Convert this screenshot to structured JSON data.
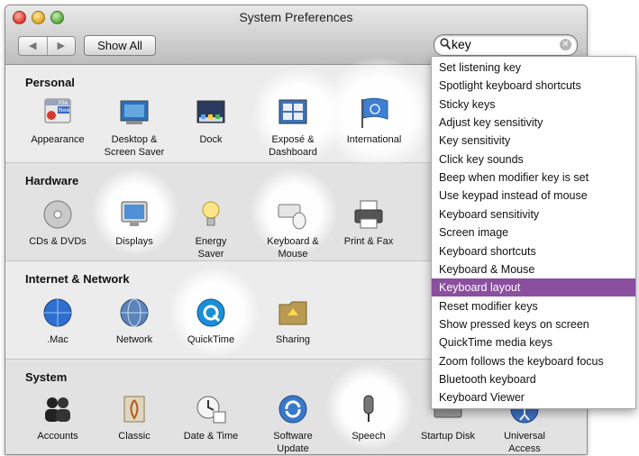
{
  "window": {
    "title": "System Preferences"
  },
  "toolbar": {
    "back": "◀",
    "forward": "▶",
    "show_all": "Show All"
  },
  "search": {
    "value": "key"
  },
  "sections": {
    "personal": "Personal",
    "hardware": "Hardware",
    "internet": "Internet & Network",
    "system": "System"
  },
  "panes": {
    "appearance": "Appearance",
    "desktop": "Desktop &\nScreen Saver",
    "dock": "Dock",
    "expose": "Exposé &\nDashboard",
    "international": "International",
    "cds": "CDs & DVDs",
    "displays": "Displays",
    "energy": "Energy\nSaver",
    "keyboard": "Keyboard &\nMouse",
    "print": "Print & Fax",
    "mac": ".Mac",
    "network": "Network",
    "quicktime": "QuickTime",
    "sharing": "Sharing",
    "accounts": "Accounts",
    "classic": "Classic",
    "datetime": "Date & Time",
    "software": "Software\nUpdate",
    "speech": "Speech",
    "startup": "Startup Disk",
    "universal": "Universal\nAccess"
  },
  "appearance_icon_text": {
    "file": "File",
    "new": "New"
  },
  "suggestions": [
    "Set listening key",
    "Spotlight keyboard shortcuts",
    "Sticky keys",
    "Adjust key sensitivity",
    "Key sensitivity",
    "Click key sounds",
    "Beep when modifier key is set",
    "Use keypad instead of mouse",
    "Keyboard sensitivity",
    "Screen image",
    "Keyboard shortcuts",
    "Keyboard & Mouse",
    "Keyboard layout",
    "Reset modifier keys",
    "Show pressed keys on screen",
    "QuickTime media keys",
    "Zoom follows the keyboard focus",
    "Bluetooth keyboard",
    "Keyboard Viewer"
  ],
  "selected_suggestion": "Keyboard layout",
  "colors": {
    "selection": "#8a4f9e"
  }
}
